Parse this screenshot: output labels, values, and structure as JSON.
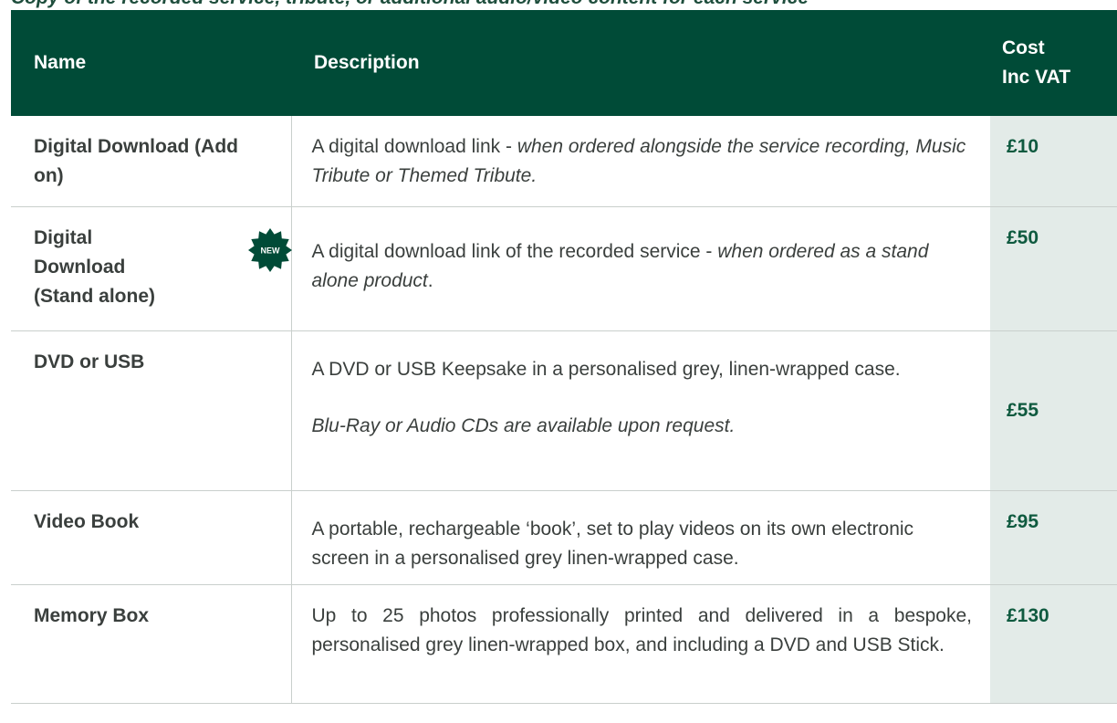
{
  "header_overflow_text": "Copy of the recorded service, tribute, or additional audio/video content for each service",
  "table": {
    "headers": {
      "name": "Name",
      "description": "Description",
      "cost_line1": "Cost",
      "cost_line2": "Inc VAT"
    },
    "rows": [
      {
        "name": "Digital Download (Add on)",
        "desc_plain": "A digital download link - ",
        "desc_italic": "when ordered alongside the service recording, Music Tribute or Themed Tribute.",
        "cost": "£10"
      },
      {
        "name_line1": "Digital",
        "name_line2": "Download",
        "name_line3": "(Stand alone)",
        "badge": "NEW",
        "desc_plain": "A digital download link of the recorded service - ",
        "desc_italic": "when ordered as a stand alone product",
        "desc_tail": ".",
        "cost": "£50"
      },
      {
        "name": "DVD or USB",
        "desc_plain": "A DVD or USB Keepsake in a personalised grey, linen-wrapped case.",
        "desc_italic": "Blu-Ray or Audio CDs are available upon request.",
        "cost": "£55"
      },
      {
        "name": "Video Book",
        "desc_plain": "A portable, rechargeable ‘book’, set to play videos on its own electronic screen in a personalised grey linen-wrapped case.",
        "cost": "£95"
      },
      {
        "name": "Memory Box",
        "desc_plain": "Up to 25 photos professionally printed and delivered in a bespoke, personalised grey linen-wrapped box, and including a DVD and USB Stick.",
        "cost": "£130"
      }
    ]
  },
  "colors": {
    "header_bg": "#004b37",
    "cost_column_bg": "#e3ebe8",
    "cost_text": "#0f5a3f"
  }
}
